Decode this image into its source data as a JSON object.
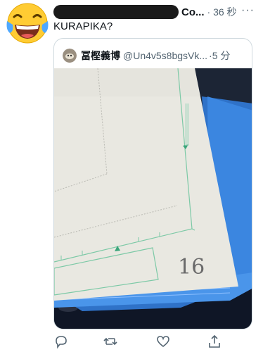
{
  "tweet": {
    "author_name": "Co...",
    "time": "36 秒",
    "text": "KURAPIKA?",
    "more_label": "···"
  },
  "quoted": {
    "name": "冨樫義博",
    "handle": "@Un4v5s8bgsVk...",
    "time": "5 分",
    "page_number": "16"
  },
  "actions": [
    "reply-icon",
    "retweet-icon",
    "like-icon",
    "share-icon"
  ]
}
